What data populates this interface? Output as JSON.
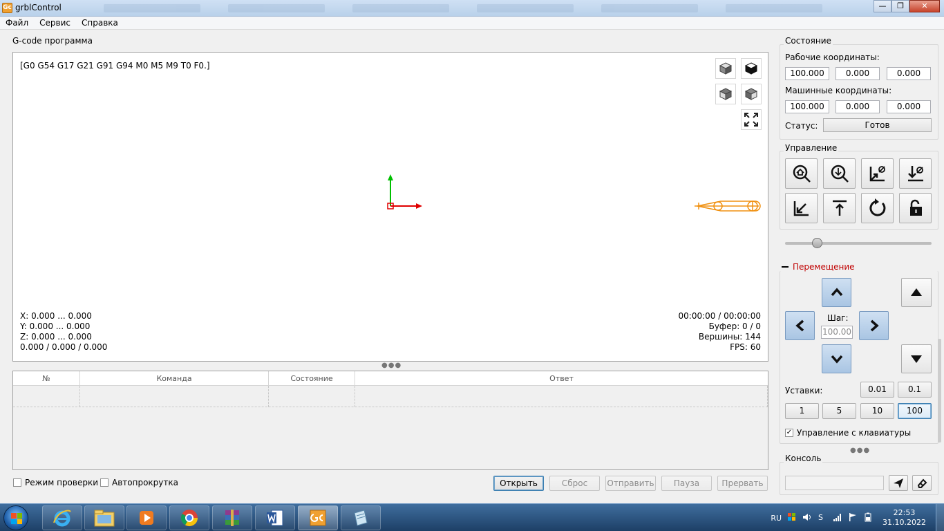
{
  "window": {
    "title": "grblControl",
    "icon_text": "Gc",
    "buttons": {
      "minimize": "—",
      "maximize": "❐",
      "close": "✕"
    }
  },
  "menu": [
    "Файл",
    "Сервис",
    "Справка"
  ],
  "gcode": {
    "group_title": "G-code программа",
    "parser_state": "[G0 G54 G17 G21 G91 G94 M0 M5 M9 T0 F0.]",
    "info_left": [
      "X: 0.000 ... 0.000",
      "Y: 0.000 ... 0.000",
      "Z: 0.000 ... 0.000",
      "0.000 / 0.000 / 0.000"
    ],
    "info_right": [
      "00:00:00 / 00:00:00",
      "Буфер: 0 / 0",
      "Вершины: 144",
      "FPS: 60"
    ],
    "view_icons": [
      "cube-iso-icon",
      "cube-top-icon",
      "cube-front-icon",
      "cube-left-icon",
      "fit-view-icon"
    ]
  },
  "table": {
    "columns": [
      "№",
      "Команда",
      "Состояние",
      "Ответ"
    ],
    "rows": [
      [
        "",
        "",
        "",
        ""
      ]
    ]
  },
  "bottom": {
    "check_mode": "Режим проверки",
    "autoscroll": "Автопрокрутка",
    "buttons": {
      "open": "Открыть",
      "reset": "Сброс",
      "send": "Отправить",
      "pause": "Пауза",
      "abort": "Прервать"
    }
  },
  "state": {
    "group_title": "Состояние",
    "work_label": "Рабочие координаты:",
    "work": [
      "100.000",
      "0.000",
      "0.000"
    ],
    "machine_label": "Машинные координаты:",
    "machine": [
      "100.000",
      "0.000",
      "0.000"
    ],
    "status_label": "Статус:",
    "status": "Готов"
  },
  "control": {
    "group_title": "Управление",
    "buttons": [
      "home-icon",
      "probe-z-icon",
      "zero-xy-icon",
      "zero-z-icon",
      "restore-origin-icon",
      "safe-position-icon",
      "reset-icon",
      "unlock-icon"
    ],
    "spindle_slider": 0.2
  },
  "jog": {
    "group_title": "Перемещение",
    "step_label": "Шаг:",
    "step_value": "100.00",
    "presets_label": "Уставки:",
    "presets": [
      "0.01",
      "0.1",
      "1",
      "5",
      "10",
      "100"
    ],
    "active_preset": "100",
    "keyboard_control": "Управление с клавиатуры"
  },
  "console": {
    "group_title": "Консоль",
    "input_value": ""
  },
  "taskbar": {
    "lang": "RU",
    "time": "22:53",
    "date": "31.10.2022"
  },
  "colors": {
    "axis_x": "#e00000",
    "axis_y": "#00c000",
    "tool": "#f09010",
    "jog_active_text": "#c00000"
  }
}
